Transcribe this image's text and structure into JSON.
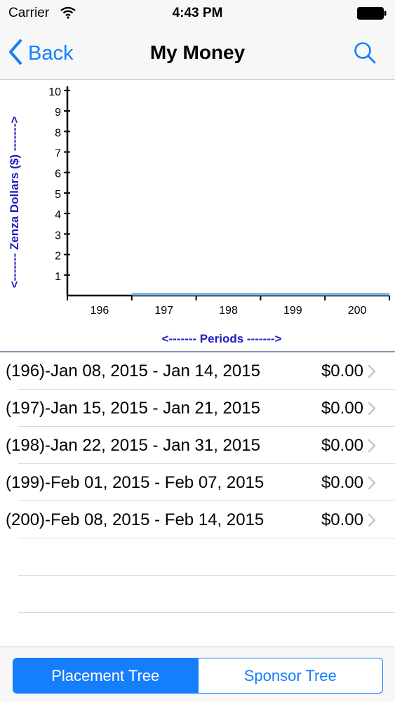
{
  "status_bar": {
    "carrier": "Carrier",
    "time": "4:43 PM",
    "wifi_icon": "wifi-icon",
    "battery_icon": "battery-full-icon"
  },
  "nav": {
    "back_label": "Back",
    "title": "My Money",
    "search_icon": "search-icon"
  },
  "colors": {
    "accent": "#157efb",
    "bar": "#7dbbe6",
    "axis_label": "#1f1ec2"
  },
  "chart_data": {
    "type": "bar",
    "xlabel": "<------- Periods ------->",
    "ylabel": "<------- Zenza Dollars ($) ------->",
    "categories": [
      "196",
      "197",
      "198",
      "199",
      "200"
    ],
    "values": [
      0,
      0,
      0,
      0,
      0
    ],
    "ylim": [
      0,
      10
    ],
    "yticks": [
      "1",
      "2",
      "3",
      "4",
      "5",
      "6",
      "7",
      "8",
      "9",
      "10"
    ]
  },
  "periods": [
    {
      "label": "(196)-Jan 08, 2015 - Jan 14, 2015",
      "amount": "$0.00"
    },
    {
      "label": "(197)-Jan 15, 2015 - Jan 21, 2015",
      "amount": "$0.00"
    },
    {
      "label": "(198)-Jan 22, 2015 - Jan 31, 2015",
      "amount": "$0.00"
    },
    {
      "label": "(199)-Feb 01, 2015 - Feb 07, 2015",
      "amount": "$0.00"
    },
    {
      "label": "(200)-Feb 08, 2015 - Feb 14, 2015",
      "amount": "$0.00"
    }
  ],
  "toolbar": {
    "segments": [
      "Placement Tree",
      "Sponsor Tree"
    ],
    "selected": "Placement Tree"
  }
}
